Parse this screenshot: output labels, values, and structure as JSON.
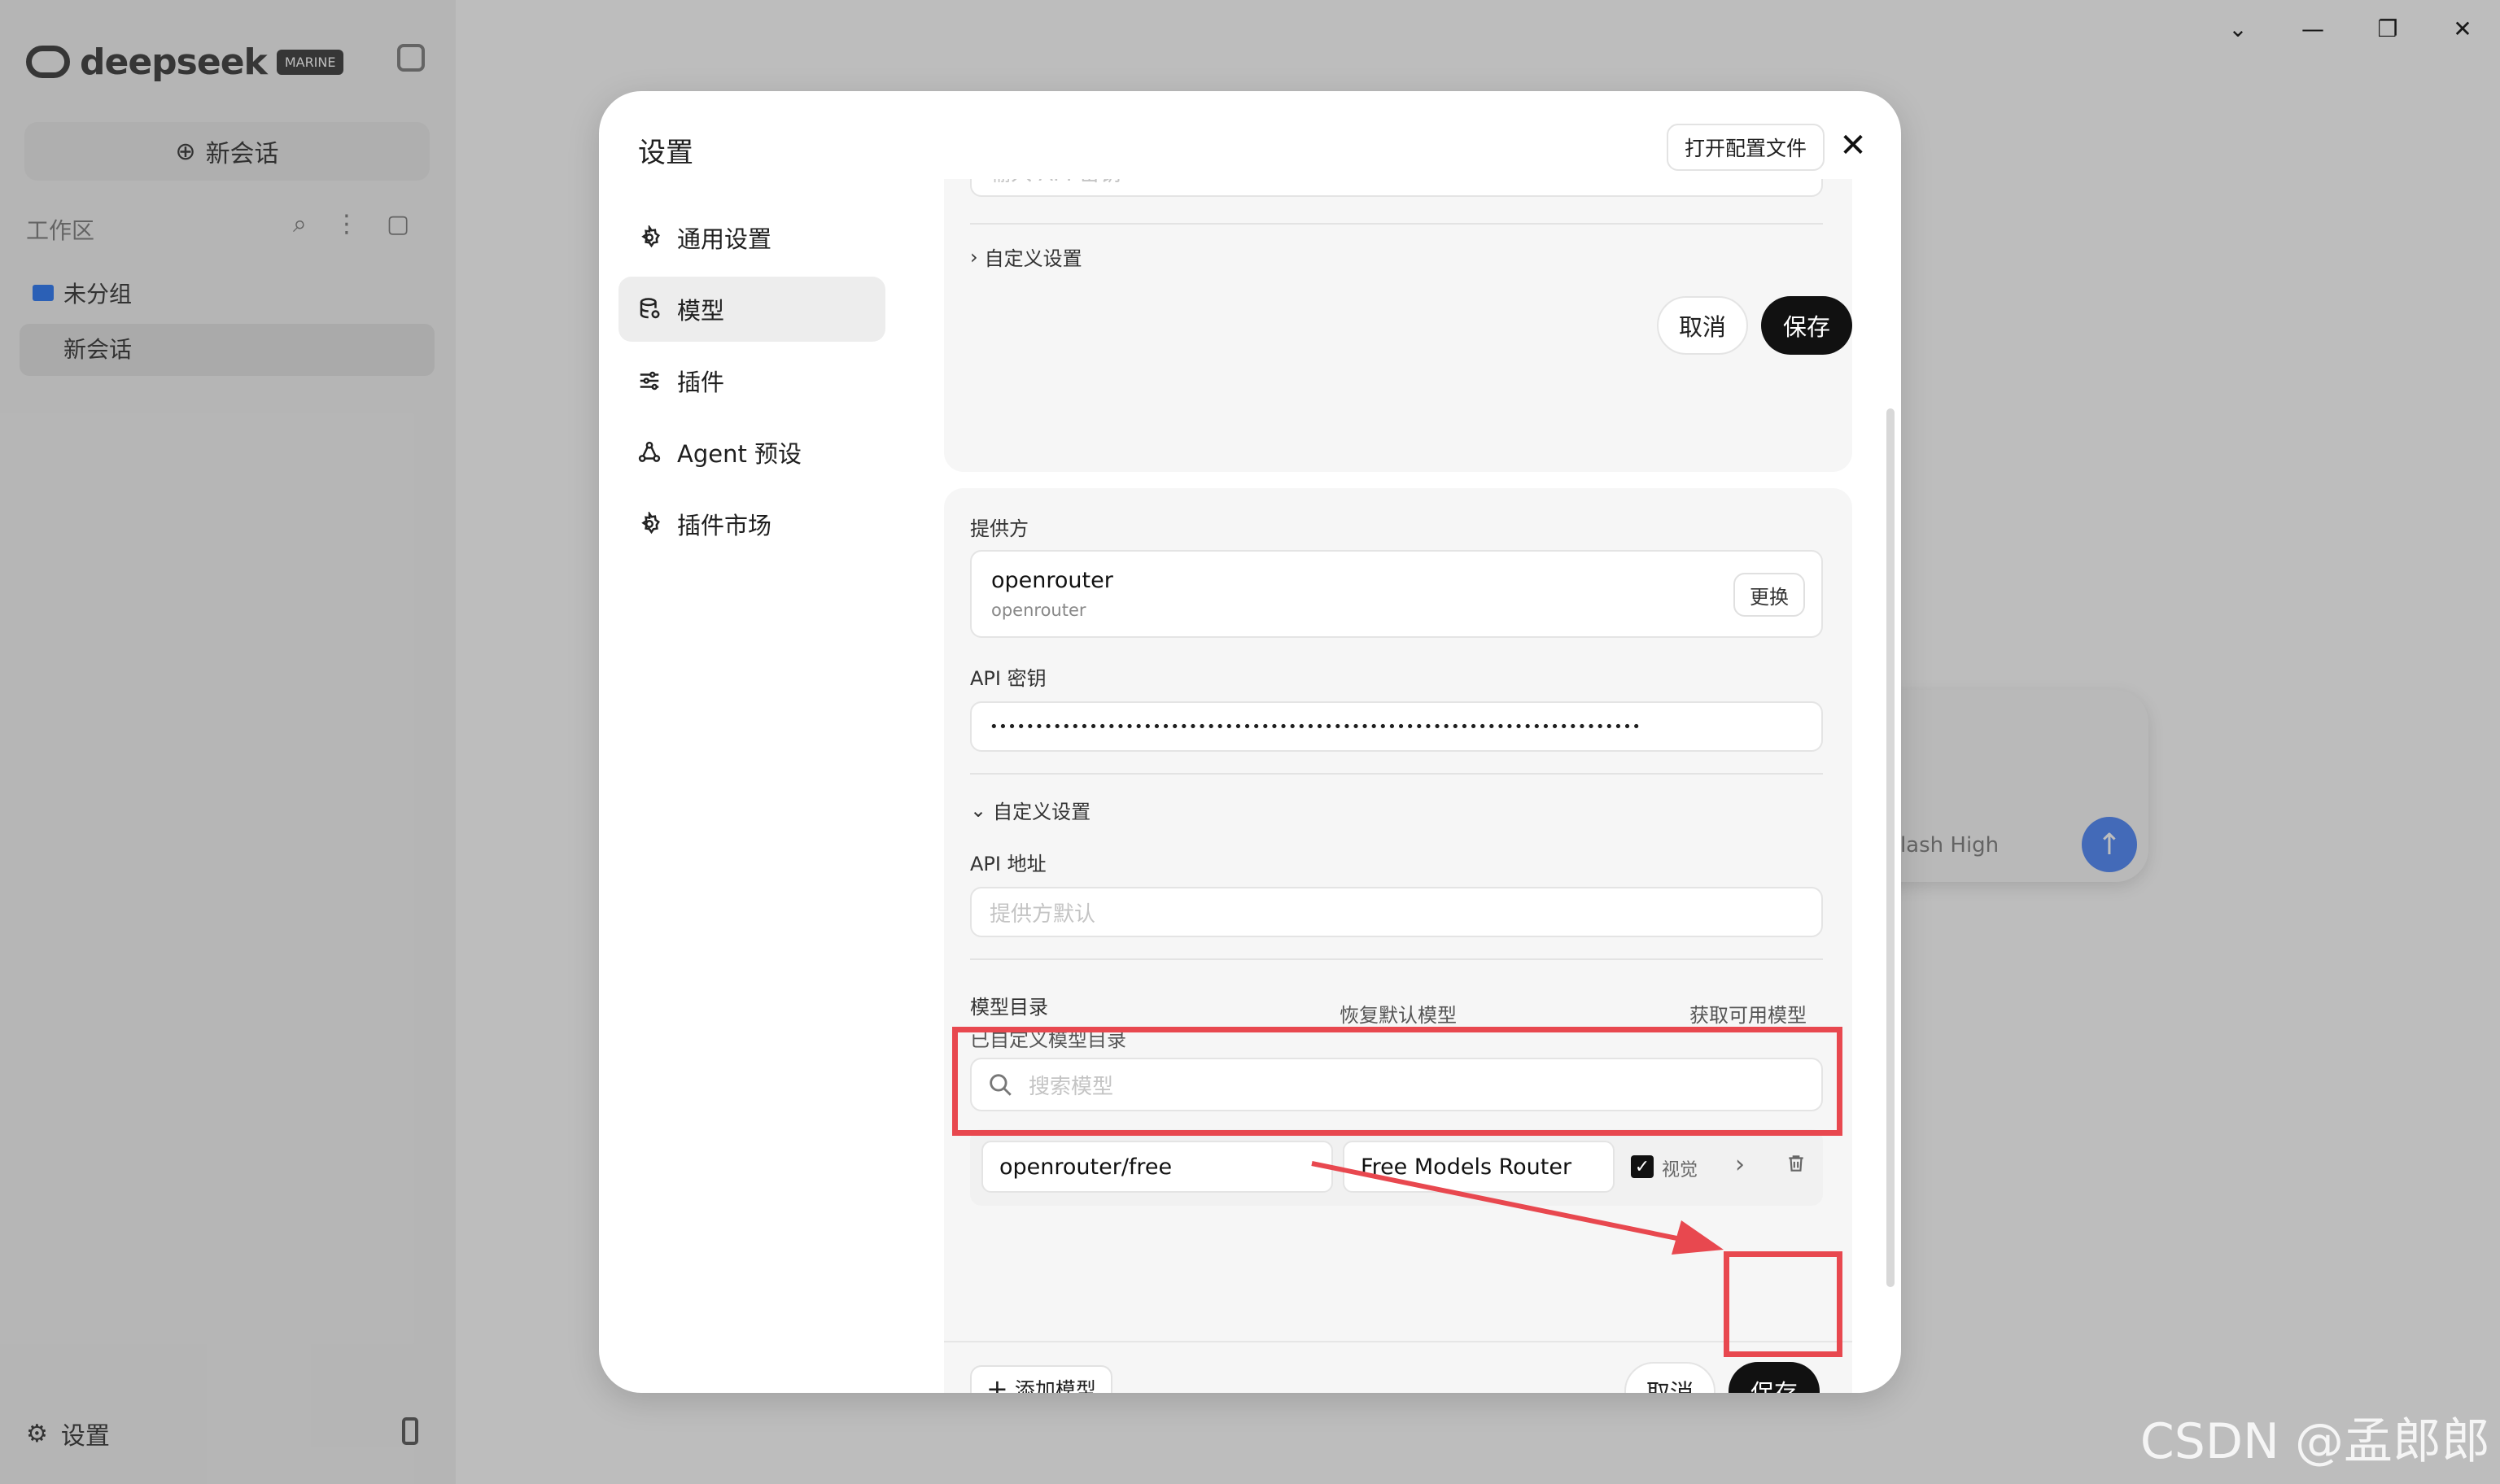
{
  "app": {
    "logo_text": "deepseek",
    "logo_badge": "MARINE",
    "new_chat": "新会话",
    "workspace_label": "工作区",
    "folder_label": "未分组",
    "chat_item": "新会话",
    "settings_label": "设置",
    "input_hint": "Flash High"
  },
  "window": {
    "min": "—",
    "restore": "❐",
    "close": "✕",
    "chev": "⌄"
  },
  "dialog": {
    "title": "设置",
    "open_config": "打开配置文件",
    "close": "✕",
    "nav": [
      {
        "label": "通用设置"
      },
      {
        "label": "模型"
      },
      {
        "label": "插件"
      },
      {
        "label": "Agent 预设"
      },
      {
        "label": "插件市场"
      }
    ]
  },
  "card1": {
    "api_key_placeholder": "输入 API 密钥",
    "custom_settings": "自定义设置",
    "cancel": "取消",
    "save": "保存"
  },
  "card2": {
    "provider_label": "提供方",
    "provider_name": "openrouter",
    "provider_sub": "openrouter",
    "change": "更换",
    "api_key_label": "API 密钥",
    "api_key_value": "••••••••••••••••••••••••••••••••••••••••••••••••••••••••••••••••••••••••",
    "custom_settings": "自定义设置",
    "api_url_label": "API 地址",
    "api_url_placeholder": "提供方默认",
    "dir_title": "模型目录",
    "dir_sub": "已自定义模型目录",
    "reset_models": "恢复默认模型",
    "fetch_models": "获取可用模型",
    "search_placeholder": "搜索模型",
    "model_id": "openrouter/free",
    "model_name": "Free Models Router",
    "vision_label": "视觉",
    "add_model": "添加模型",
    "cancel": "取消",
    "save": "保存"
  },
  "watermark": "CSDN @孟郎郎",
  "colors": {
    "highlight": "#e8484f",
    "accent_dark": "#111111"
  }
}
